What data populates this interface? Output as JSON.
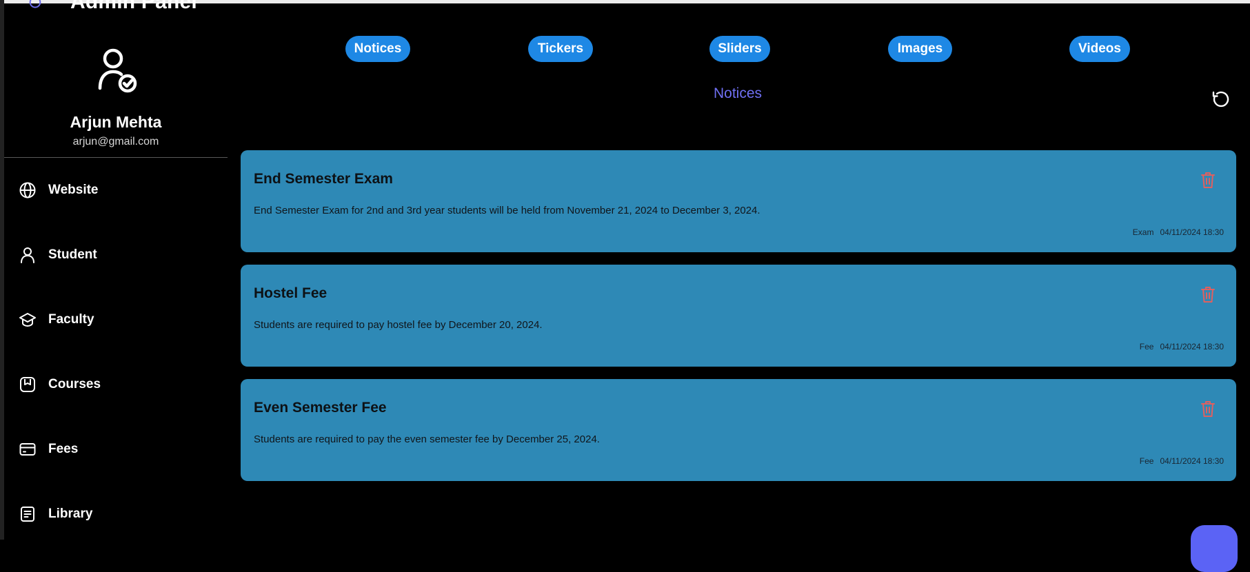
{
  "header": {
    "title": "Admin Panel"
  },
  "profile": {
    "name": "Arjun Mehta",
    "email": "arjun@gmail.com"
  },
  "sidebar": {
    "items": [
      {
        "label": "Website",
        "icon": "globe-icon"
      },
      {
        "label": "Student",
        "icon": "user-icon"
      },
      {
        "label": "Faculty",
        "icon": "graduation-cap-icon"
      },
      {
        "label": "Courses",
        "icon": "book-icon"
      },
      {
        "label": "Fees",
        "icon": "credit-card-icon"
      },
      {
        "label": "Library",
        "icon": "document-icon"
      }
    ]
  },
  "tabs": [
    {
      "label": "Notices"
    },
    {
      "label": "Tickers"
    },
    {
      "label": "Sliders"
    },
    {
      "label": "Images"
    },
    {
      "label": "Videos"
    }
  ],
  "section": {
    "title": "Notices"
  },
  "notices": [
    {
      "title": "End Semester Exam",
      "description": "End Semester Exam for 2nd and 3rd year students will be held from November 21, 2024 to December 3, 2024.",
      "category": "Exam",
      "datetime": "04/11/2024 18:30"
    },
    {
      "title": "Hostel Fee",
      "description": "Students are required to pay hostel fee by December 20, 2024.",
      "category": "Fee",
      "datetime": "04/11/2024 18:30"
    },
    {
      "title": "Even Semester Fee",
      "description": "Students are required to pay the even semester fee by December 25, 2024.",
      "category": "Fee",
      "datetime": "04/11/2024 18:30"
    }
  ],
  "colors": {
    "background": "#000000",
    "tab": "#1e88e5",
    "section_title": "#6f6ff2",
    "card": "#2e89b6",
    "delete_icon": "#e06060",
    "fab": "#5b63f5"
  }
}
